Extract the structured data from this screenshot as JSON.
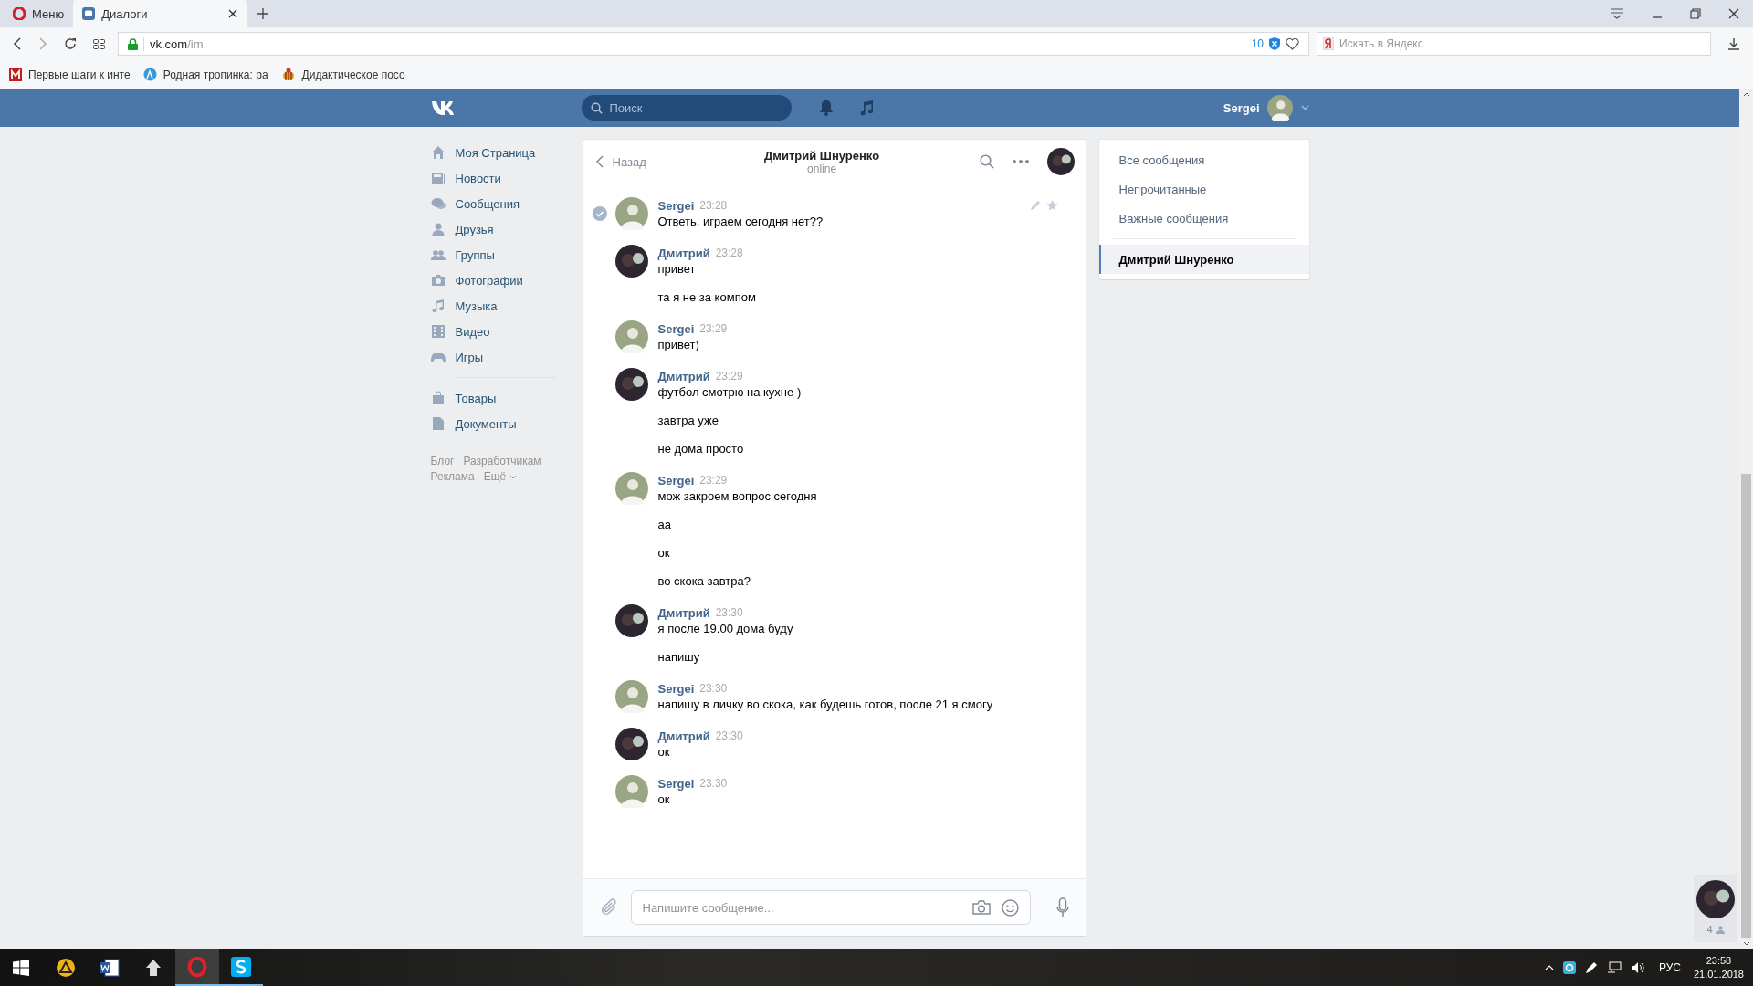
{
  "browser": {
    "tabs": [
      {
        "label": "Меню",
        "kind": "menu",
        "selected": false
      },
      {
        "label": "Диалоги",
        "kind": "page",
        "selected": true
      }
    ],
    "address_host": "vk.com",
    "address_path": "/im",
    "blocked_count": "10",
    "search_placeholder": "Искать в Яндекс",
    "bookmarks": [
      {
        "label": "Первые шаги к инте",
        "kind": "mail"
      },
      {
        "label": "Родная тропинка: ра",
        "kind": "globe"
      },
      {
        "label": "Дидактическое посо",
        "kind": "bee"
      }
    ]
  },
  "header": {
    "search_placeholder": "Поиск",
    "user_name": "Sergei"
  },
  "nav": {
    "items": [
      {
        "label": "Моя Страница",
        "kind": "home"
      },
      {
        "label": "Новости",
        "kind": "news"
      },
      {
        "label": "Сообщения",
        "kind": "messages"
      },
      {
        "label": "Друзья",
        "kind": "friend"
      },
      {
        "label": "Группы",
        "kind": "group"
      },
      {
        "label": "Фотографии",
        "kind": "camera"
      },
      {
        "label": "Музыка",
        "kind": "music"
      },
      {
        "label": "Видео",
        "kind": "video"
      },
      {
        "label": "Игры",
        "kind": "game"
      }
    ],
    "secondary": [
      {
        "label": "Товары",
        "kind": "bag"
      },
      {
        "label": "Документы",
        "kind": "doc"
      }
    ],
    "footer_links": [
      "Блог",
      "Разработчикам",
      "Реклама",
      "Ещё"
    ]
  },
  "chat": {
    "back": "Назад",
    "title": "Дмитрий Шнуренко",
    "status": "online",
    "messages": [
      {
        "author": "Sergei",
        "kind": "self",
        "time": "23:28",
        "selected": true,
        "lines": [
          "Ответь, играем сегодня нет??"
        ]
      },
      {
        "author": "Дмитрий",
        "kind": "peer",
        "time": "23:28",
        "selected": false,
        "lines": [
          "привет",
          "та я не за компом"
        ]
      },
      {
        "author": "Sergei",
        "kind": "self",
        "time": "23:29",
        "selected": false,
        "lines": [
          "привет)"
        ]
      },
      {
        "author": "Дмитрий",
        "kind": "peer",
        "time": "23:29",
        "selected": false,
        "lines": [
          "футбол смотрю на кухне )",
          "завтра уже",
          "не дома просто"
        ]
      },
      {
        "author": "Sergei",
        "kind": "self",
        "time": "23:29",
        "selected": false,
        "lines": [
          "мож закроем вопрос сегодня",
          "аа",
          "ок",
          "во скока завтра?"
        ]
      },
      {
        "author": "Дмитрий",
        "kind": "peer",
        "time": "23:30",
        "selected": false,
        "lines": [
          "я после 19.00 дома буду",
          "напишу"
        ]
      },
      {
        "author": "Sergei",
        "kind": "self",
        "time": "23:30",
        "selected": false,
        "lines": [
          "напишу в личку во скока, как будешь готов, после 21 я смогу"
        ]
      },
      {
        "author": "Дмитрий",
        "kind": "peer",
        "time": "23:30",
        "selected": false,
        "lines": [
          "ок"
        ]
      },
      {
        "author": "Sergei",
        "kind": "self",
        "time": "23:30",
        "selected": false,
        "lines": [
          "ок"
        ]
      }
    ],
    "input_placeholder": "Напишите сообщение..."
  },
  "filters": {
    "items": [
      {
        "label": "Все сообщения",
        "selected": false
      },
      {
        "label": "Непрочитанные",
        "selected": false
      },
      {
        "label": "Важные сообщения",
        "selected": false
      }
    ],
    "conversations": [
      {
        "label": "Дмитрий Шнуренко",
        "selected": true
      }
    ]
  },
  "corner": {
    "count": "4"
  },
  "taskbar": {
    "language": "РУС",
    "time": "23:58",
    "date": "21.01.2018"
  }
}
